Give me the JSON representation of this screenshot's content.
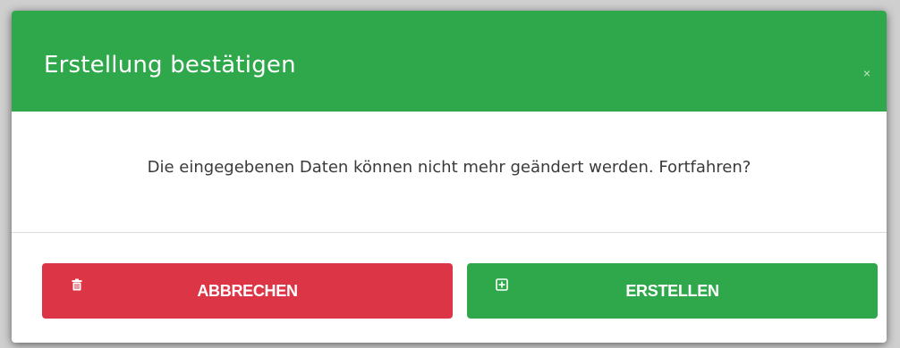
{
  "modal": {
    "title": "Erstellung bestätigen",
    "close_label": "×",
    "message": "Die eingegebenen Daten können nicht mehr geändert werden. Fortfahren?"
  },
  "buttons": {
    "cancel": {
      "label": "ABBRECHEN",
      "icon": "trash-icon",
      "color": "#dc3545"
    },
    "create": {
      "label": "ERSTELLEN",
      "icon": "plus-square-icon",
      "color": "#2ea84a"
    }
  },
  "colors": {
    "header": "#2ea84a",
    "danger": "#dc3545",
    "success": "#2ea84a"
  }
}
